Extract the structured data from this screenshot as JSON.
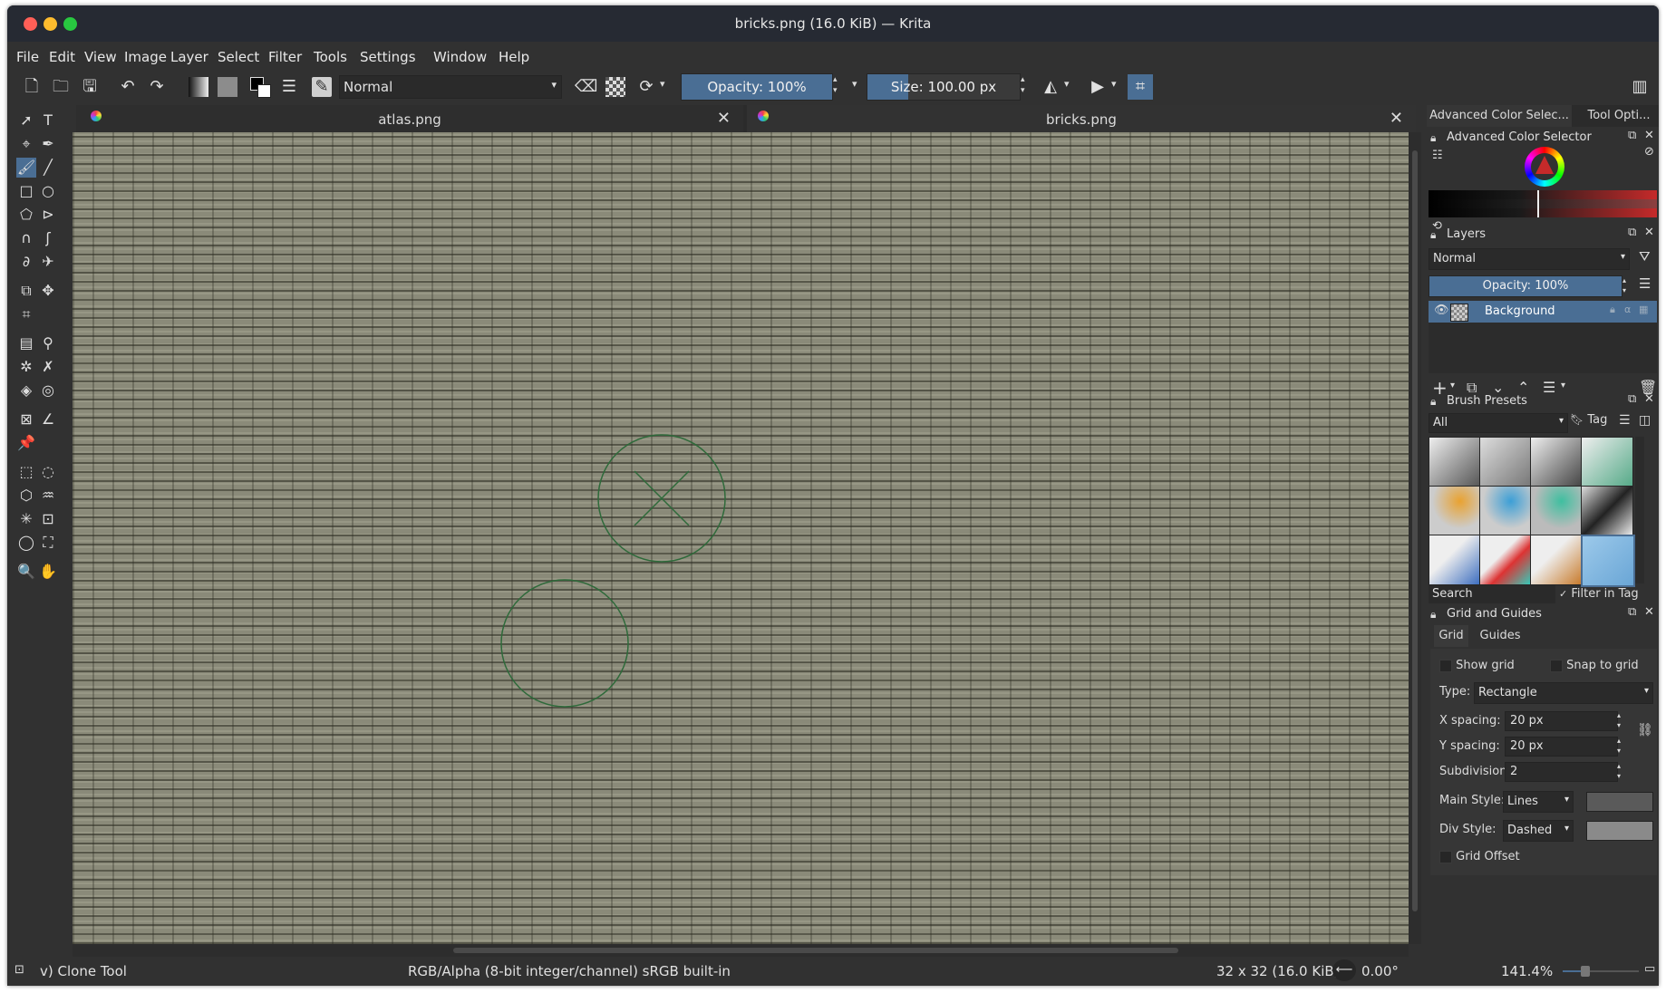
{
  "window": {
    "title": "bricks.png (16.0 KiB) — Krita"
  },
  "menu": [
    "File",
    "Edit",
    "View",
    "Image",
    "Layer",
    "Select",
    "Filter",
    "Tools",
    "Settings",
    "Window",
    "Help"
  ],
  "toolbar": {
    "blend_mode": "Normal",
    "opacity_label": "Opacity: 100%",
    "opacity_value": 1.0,
    "size_label": "Size: 100.00 px",
    "size_value_fraction": 0.27
  },
  "tabs": [
    {
      "label": "atlas.png",
      "active": false
    },
    {
      "label": "bricks.png",
      "active": true
    }
  ],
  "panel": {
    "top_tabs": [
      "Advanced Color Selec...",
      "Tool Opti..."
    ],
    "color_selector": {
      "title": "Advanced Color Selector",
      "accent": "#c52a2a"
    },
    "layers": {
      "title": "Layers",
      "blend_mode": "Normal",
      "opacity_label": "Opacity: 100%",
      "items": [
        {
          "name": "Background",
          "selected": true
        }
      ]
    },
    "brush_presets": {
      "title": "Brush Presets",
      "filter": "All",
      "tag_label": "Tag",
      "search_placeholder": "Search",
      "filter_in_tag_label": "Filter in Tag",
      "filter_in_tag_checked": true
    },
    "grid_guides": {
      "title": "Grid and Guides",
      "tabs": [
        "Grid",
        "Guides"
      ],
      "show_grid_label": "Show grid",
      "snap_to_grid_label": "Snap to grid",
      "type_label": "Type:",
      "type_value": "Rectangle",
      "x_spacing_label": "X spacing:",
      "x_spacing_value": "20 px",
      "y_spacing_label": "Y spacing:",
      "y_spacing_value": "20 px",
      "subdivision_label": "Subdivision:",
      "subdivision_value": "2",
      "main_style_label": "Main Style:",
      "main_style_value": "Lines",
      "div_style_label": "Div Style:",
      "div_style_value": "Dashed",
      "grid_offset_label": "Grid Offset"
    }
  },
  "status": {
    "tool": "v) Clone Tool",
    "color_space": "RGB/Alpha (8-bit integer/channel)  sRGB built-in",
    "image_size": "32 x 32 (16.0 KiB)",
    "rotation": "0.00°",
    "zoom": "141.4%"
  },
  "colors": {
    "background_chrome": "#313131",
    "titlebar": "#262a33",
    "selection": "#4a6e94",
    "canvas_texture": "#8a8a79",
    "brush_outline": "#2e6a3a"
  }
}
